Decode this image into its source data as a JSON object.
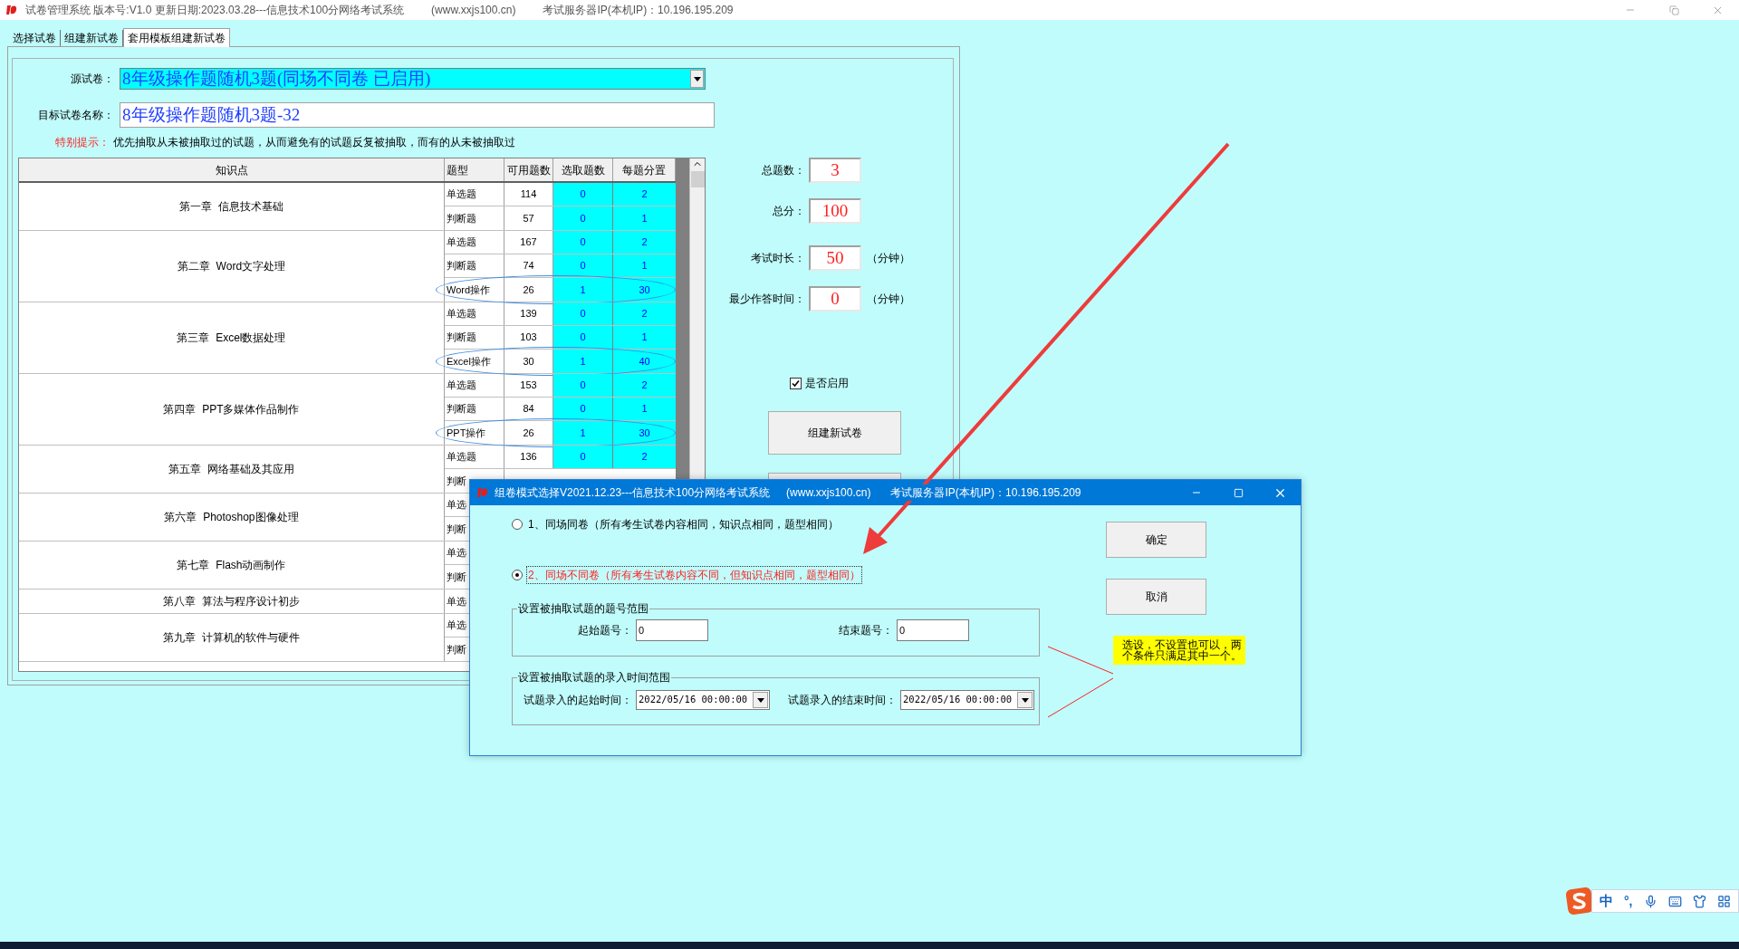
{
  "window": {
    "title": "试卷管理系统 版本号:V1.0 更新日期:2023.03.28---信息技术100分网络考试系统",
    "website": "(www.xxjs100.cn)",
    "server": "考试服务器IP(本机IP)：10.196.195.209"
  },
  "tabs": [
    {
      "label": "选择试卷",
      "selected": false
    },
    {
      "label": "组建新试卷",
      "selected": false
    },
    {
      "label": "套用模板组建新试卷",
      "selected": true
    }
  ],
  "form": {
    "source_label": "源试卷：",
    "source_value": "8年级操作题随机3题(同场不同卷  已启用)",
    "target_label": "目标试卷名称：",
    "target_value": "8年级操作题随机3题-32",
    "notice_label": "特别提示：",
    "notice_text": "优先抽取从未被抽取过的试题，从而避免有的试题反复被抽取，而有的从未被抽取过"
  },
  "table": {
    "columns": [
      "知识点",
      "题型",
      "可用题数",
      "选取题数",
      "每题分置"
    ],
    "chapters": [
      {
        "name": "第一章  信息技术基础",
        "rows": [
          {
            "type": "单选题",
            "available": "114",
            "picked": "0",
            "score": "2",
            "circled": false
          },
          {
            "type": "判断题",
            "available": "57",
            "picked": "0",
            "score": "1",
            "circled": false
          }
        ]
      },
      {
        "name": "第二章  Word文字处理",
        "rows": [
          {
            "type": "单选题",
            "available": "167",
            "picked": "0",
            "score": "2",
            "circled": false
          },
          {
            "type": "判断题",
            "available": "74",
            "picked": "0",
            "score": "1",
            "circled": false
          },
          {
            "type": "Word操作",
            "available": "26",
            "picked": "1",
            "score": "30",
            "circled": true
          }
        ]
      },
      {
        "name": "第三章  Excel数据处理",
        "rows": [
          {
            "type": "单选题",
            "available": "139",
            "picked": "0",
            "score": "2",
            "circled": false
          },
          {
            "type": "判断题",
            "available": "103",
            "picked": "0",
            "score": "1",
            "circled": false
          },
          {
            "type": "Excel操作",
            "available": "30",
            "picked": "1",
            "score": "40",
            "circled": true
          }
        ]
      },
      {
        "name": "第四章  PPT多媒体作品制作",
        "rows": [
          {
            "type": "单选题",
            "available": "153",
            "picked": "0",
            "score": "2",
            "circled": false
          },
          {
            "type": "判断题",
            "available": "84",
            "picked": "0",
            "score": "1",
            "circled": false
          },
          {
            "type": "PPT操作",
            "available": "26",
            "picked": "1",
            "score": "30",
            "circled": true
          }
        ]
      },
      {
        "name": "第五章  网络基础及其应用",
        "rows": [
          {
            "type": "单选题",
            "available": "136",
            "picked": "0",
            "score": "2",
            "circled": false
          },
          {
            "type": "判断"
          }
        ]
      },
      {
        "name": "第六章  Photoshop图像处理",
        "rows": [
          {
            "type": "单选"
          },
          {
            "type": "判断"
          }
        ]
      },
      {
        "name": "第七章  Flash动画制作",
        "rows": [
          {
            "type": "单选"
          },
          {
            "type": "判断"
          }
        ]
      },
      {
        "name": "第八章  算法与程序设计初步",
        "rows": [
          {
            "type": "单选"
          }
        ]
      },
      {
        "name": "第九章  计算机的软件与硬件",
        "rows": [
          {
            "type": "单选"
          },
          {
            "type": "判断"
          }
        ]
      }
    ]
  },
  "summary": {
    "fields": [
      {
        "label": "总题数：",
        "value": "3"
      },
      {
        "label": "总分：",
        "value": "100"
      },
      {
        "label": "考试时长：",
        "value": "50",
        "unit": "（分钟）"
      },
      {
        "label": "最少作答时间：",
        "value": "0",
        "unit": "（分钟）"
      }
    ],
    "enabled": {
      "label": "是否启用",
      "checked": true
    },
    "button": "组建新试卷"
  },
  "dialog": {
    "title": "组卷模式选择V2021.12.23---信息技术100分网络考试系统",
    "website": "(www.xxjs100.cn)",
    "server": "考试服务器IP(本机IP)：10.196.195.209",
    "options": [
      {
        "label": "1、同场同卷（所有考生试卷内容相同，知识点相同，题型相同）",
        "selected": false
      },
      {
        "label": "2、同场不同卷（所有考生试卷内容不同，但知识点相同，题型相同）",
        "selected": true
      }
    ],
    "number_range": {
      "title": "设置被抽取试题的题号范围",
      "start_label": "起始题号：",
      "start_value": "0",
      "end_label": "结束题号：",
      "end_value": "0"
    },
    "time_range": {
      "title": "设置被抽取试题的录入时间范围",
      "start_label": "试题录入的起始时间：",
      "start_value": "2022/05/16 00:00:00",
      "end_label": "试题录入的结束时间：",
      "end_value": "2022/05/16 00:00:00"
    },
    "buttons": [
      "确定",
      "取消"
    ],
    "note": "选设，不设置也可以，两个条件只满足其中一个。"
  },
  "ime": {
    "language": "中",
    "punctuation": "°,"
  }
}
